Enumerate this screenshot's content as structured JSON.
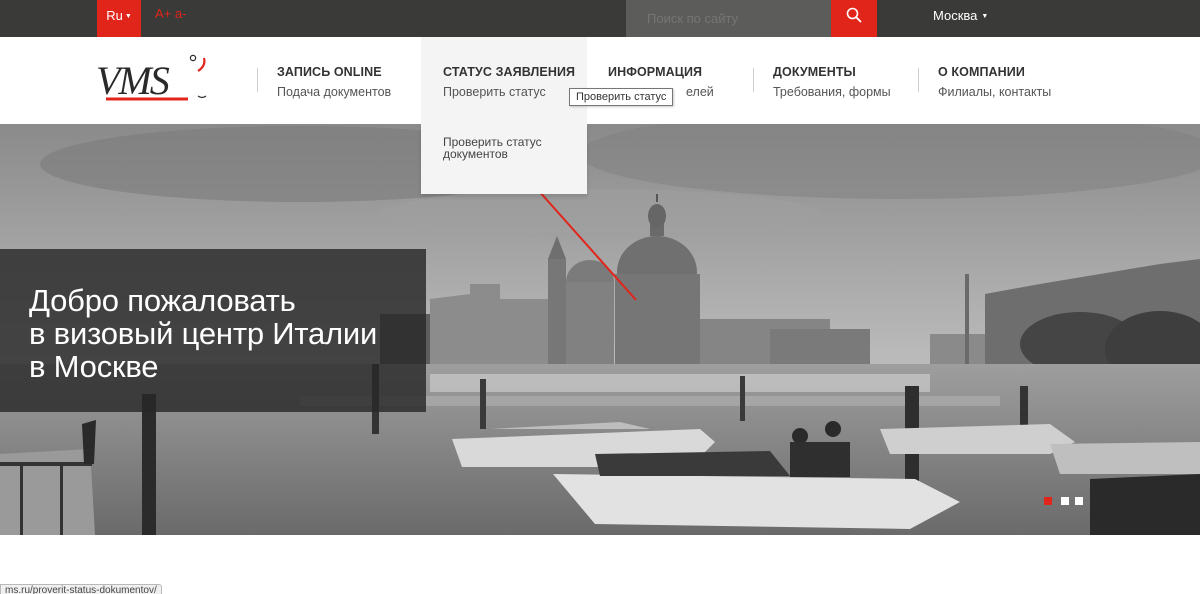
{
  "topbar": {
    "language": "Ru",
    "font_increase": "A+",
    "font_decrease": "a-",
    "search_placeholder": "Поиск по сайту",
    "city": "Москва"
  },
  "nav": [
    {
      "title": "ЗАПИСЬ ONLINE",
      "sub": "Подача документов"
    },
    {
      "title": "СТАТУС ЗАЯВЛЕНИЯ",
      "sub": "Проверить статус"
    },
    {
      "title": "ИНФОРМАЦИЯ",
      "sub": "елей"
    },
    {
      "title": "ДОКУМЕНТЫ",
      "sub": "Требования, формы"
    },
    {
      "title": "О КОМПАНИИ",
      "sub": "Филиалы, контакты"
    }
  ],
  "dropdown": {
    "item": "Проверить статус документов"
  },
  "tooltip": "Проверить статус",
  "hero": {
    "line1": "Добро пожаловать",
    "line2": "в визовый центр Италии",
    "line3": "в Москве",
    "slides": 3,
    "active_slide": 1
  },
  "statusbar": "ms.ru/proverit-status-dokumentov/",
  "colors": {
    "accent": "#e1251b",
    "topbar": "#3a3a38"
  }
}
